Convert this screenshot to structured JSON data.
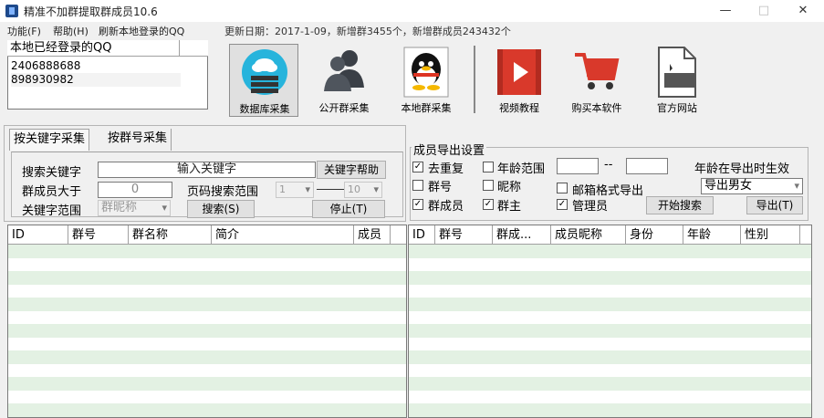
{
  "window": {
    "title": "精准不加群提取群成员10.6",
    "minimize": "—",
    "maximize": "□",
    "close": "✕"
  },
  "menu": {
    "items": [
      "功能(F)",
      "帮助(H)",
      "刷新本地登录的QQ"
    ]
  },
  "update_info": "更新日期：2017-1-09，新增群3455个，新增群成员243432个",
  "logged_in": {
    "header": "本地已经登录的QQ",
    "accounts": [
      "2406888688",
      "898930982"
    ]
  },
  "toolbar": [
    {
      "label": "数据库采集",
      "icon": "database-cloud-icon"
    },
    {
      "label": "公开群采集",
      "icon": "users-icon"
    },
    {
      "label": "本地群采集",
      "icon": "qq-penguin-icon"
    },
    {
      "label": "视频教程",
      "icon": "video-play-icon"
    },
    {
      "label": "购买本软件",
      "icon": "shopping-cart-icon"
    },
    {
      "label": "官方网站",
      "icon": "website-file-icon"
    }
  ],
  "tabs": [
    "按关键字采集",
    "按群号采集"
  ],
  "search": {
    "keyword_label": "搜索关键字",
    "keyword_placeholder": "输入关键字",
    "help_button": "关键字帮助",
    "members_label": "群成员大于",
    "members_value": "0",
    "page_range_label": "页码搜索范围",
    "page_from": "1",
    "page_to": "10",
    "scope_label": "关键字范围",
    "scope_value": "群昵称",
    "search_button": "搜索(S)",
    "stop_button": "停止(T)"
  },
  "export": {
    "title": "成员导出设置",
    "dedupe": "去重复",
    "age_range": "年龄范围",
    "age_sep": "--",
    "age_note": "年龄在导出时生效",
    "group_no": "群号",
    "nickname": "昵称",
    "email_format": "邮箱格式导出",
    "gender_value": "导出男女",
    "members": "群成员",
    "owner": "群主",
    "admin": "管理员",
    "start_button": "开始搜索",
    "export_button": "导出(T)"
  },
  "left_columns": [
    "ID",
    "群号",
    "群名称",
    "简介",
    "成员"
  ],
  "right_columns": [
    "ID",
    "群号",
    "群成...",
    "成员昵称",
    "身份",
    "年龄",
    "性别"
  ],
  "colors": {
    "row_stripe": "#e3f1e3",
    "window_bg": "#f0f0f0"
  }
}
